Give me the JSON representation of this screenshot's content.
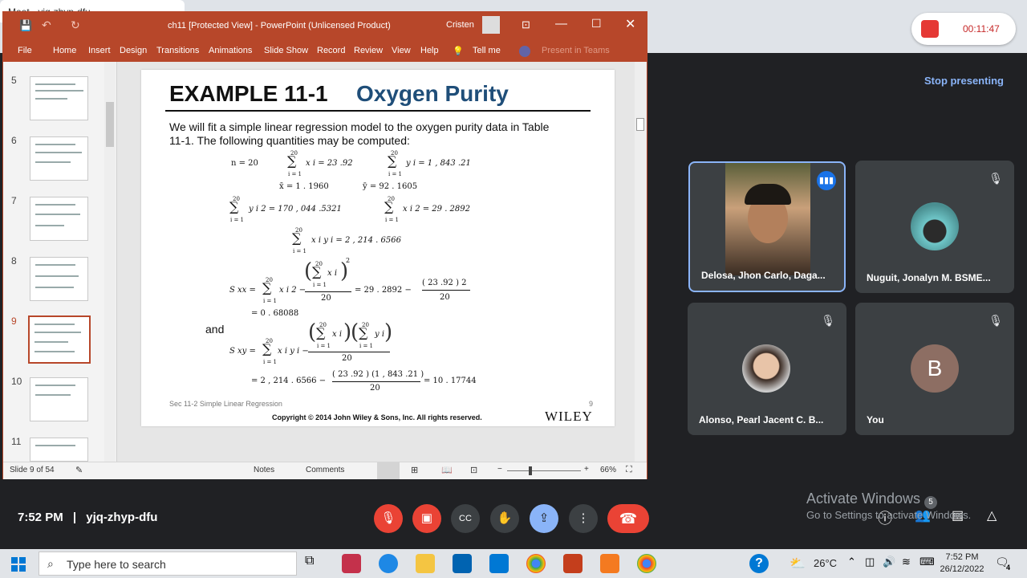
{
  "browser": {
    "tab_title": "Meet - yjq-zhyp-dfu",
    "recording_time": "00:11:47"
  },
  "meet": {
    "stop_presenting": "Stop presenting",
    "participants": [
      {
        "name": "Delosa, Jhon Carlo, Daga..."
      },
      {
        "name": "Nuguit, Jonalyn M. BSME..."
      },
      {
        "name": "Alonso, Pearl Jacent C. B..."
      },
      {
        "name": "You",
        "initial": "B"
      }
    ],
    "time": "7:52 PM",
    "separator": "|",
    "meeting_code": "yjq-zhyp-dfu",
    "people_count": "5",
    "activate_title": "Activate Windows",
    "activate_sub": "Go to Settings to activate Windows."
  },
  "ppt": {
    "title": "ch11 [Protected View]  -  PowerPoint (Unlicensed Product)",
    "user": "Cristen",
    "menu": [
      "File",
      "Home",
      "Insert",
      "Design",
      "Transitions",
      "Animations",
      "Slide Show",
      "Record",
      "Review",
      "View",
      "Help",
      "Tell me",
      "Present in Teams"
    ],
    "thumb_numbers": [
      "5",
      "6",
      "7",
      "8",
      "9",
      "10",
      "11"
    ],
    "status_slide": "Slide 9 of 54",
    "notes": "Notes",
    "comments": "Comments",
    "zoom": "66%"
  },
  "slide": {
    "title_left": "EXAMPLE 11-1",
    "title_right": "Oxygen Purity",
    "intro": "We will fit a simple linear regression model to the oxygen purity data in Table 11-1. The following quantities may be computed:",
    "eq_n": "n  =  20",
    "eq_sumx": "x i  =  23  .92",
    "eq_sumy": "y i  =  1 , 843   .21",
    "eq_xbar": "x̄  =  1 . 1960",
    "eq_ybar": "ȳ  =  92  . 1605",
    "eq_sumy2": "y i 2  =  170   , 044   .5321",
    "eq_sumx2": "x i 2  =  29   . 2892",
    "eq_sumxy": "x i y i  =  2 , 214   . 6566",
    "sxx_label": "S xx  =",
    "sxx_part1": "x i 2  −",
    "sxx_part2": "=  29  . 2892   −",
    "sxx_frac_num": "( 23  .92 ) 2",
    "sxx_frac_den": "20",
    "sxx_result": "=  0 . 68088",
    "and": "and",
    "sxy_label": "S xy  =",
    "sxy_part1": "x i y i  −",
    "sxy_den": "20",
    "sxy_result_a": "=  2 , 214   . 6566   −",
    "sxy_result_num": "( 23  .92 ) (1 , 843   .21 )",
    "sxy_result_den": "20",
    "sxy_result_b": "=  10  . 17744",
    "sigma_upper": "20",
    "sigma_lower": "i = 1",
    "xi_sym": "x i",
    "yi_sym": "y i",
    "footer_left": "Sec 11-2 Simple Linear Regression",
    "page_num": "9",
    "copyright": "Copyright © 2014 John Wiley & Sons, Inc. All rights reserved.",
    "publisher": "WILEY"
  },
  "taskbar": {
    "search_placeholder": "Type here to search",
    "temperature": "26°C",
    "clock_time": "7:52 PM",
    "clock_date": "26/12/2022",
    "notifications": "4"
  }
}
